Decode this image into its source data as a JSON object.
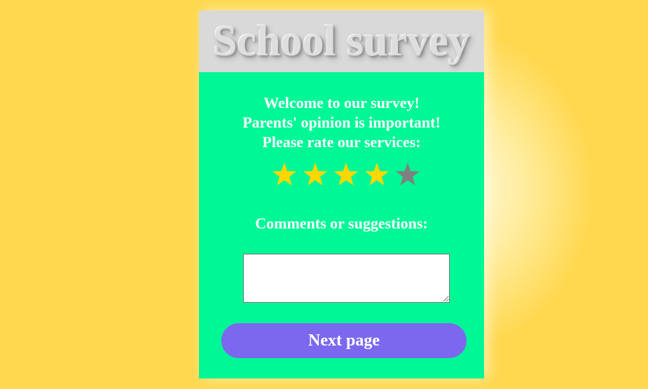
{
  "header": {
    "title": "School survey"
  },
  "intro": {
    "line1": "Welcome to our survey!",
    "line2": "Parents' opinion is important!",
    "line3": "Please rate our services:"
  },
  "rating": {
    "value": 4,
    "max": 5,
    "filled_color": "#ffd700",
    "empty_color": "#808080"
  },
  "comments": {
    "label": "Comments or suggestions:",
    "value": ""
  },
  "next_button": {
    "label": "Next page"
  },
  "colors": {
    "background": "#ffd84f",
    "card": "#00f796",
    "header": "#d9d9d9",
    "button": "#7b68ee"
  }
}
